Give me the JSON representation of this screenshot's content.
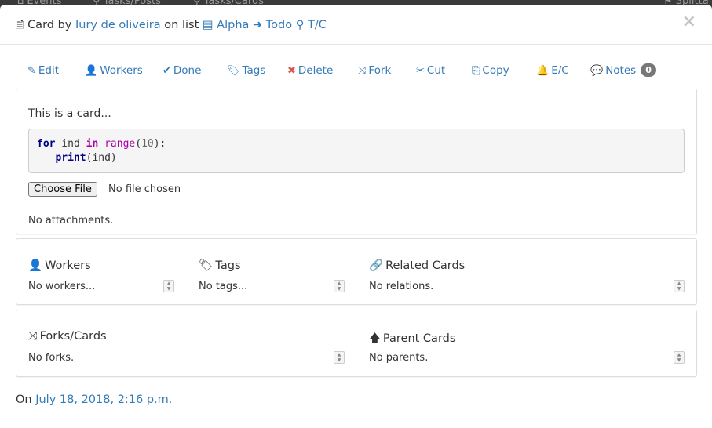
{
  "backdrop": {
    "nav_events": "Events",
    "nav_posts": "Tasks/Posts",
    "nav_cards": "Tasks/Cards",
    "nav_split": "Splitta"
  },
  "header": {
    "prefix": "Card by",
    "author": "Iury de oliveira",
    "on_list": "on list",
    "board": "Alpha",
    "list": "Todo",
    "search": "T/C",
    "close": "×"
  },
  "toolbar": {
    "edit": "Edit",
    "workers": "Workers",
    "done": "Done",
    "tags": "Tags",
    "delete": "Delete",
    "fork": "Fork",
    "cut": "Cut",
    "copy": "Copy",
    "ec": "E/C",
    "notes": "Notes",
    "notes_count": "0"
  },
  "card": {
    "text": "This is a card...",
    "code_line1_kw": "for",
    "code_line1_var": " ind ",
    "code_line1_in": "in",
    "code_line1_fn": " range",
    "code_line1_open": "(",
    "code_line1_num": "10",
    "code_line1_close": "):",
    "code_line2_fn": "print",
    "code_line2_rest": "(ind)",
    "file_button": "Choose File",
    "file_status": "No file chosen",
    "attachments": "No attachments."
  },
  "relations": {
    "workers_title": "Workers",
    "workers_value": "No workers...",
    "tags_title": "Tags",
    "tags_value": "No tags...",
    "related_title": "Related Cards",
    "related_value": "No relations.",
    "forks_title": "Forks/Cards",
    "forks_value": "No forks.",
    "parent_title": "Parent Cards",
    "parent_value": "No parents."
  },
  "footer": {
    "prefix": "On",
    "date": "July 18, 2018, 2:16 p.m."
  }
}
